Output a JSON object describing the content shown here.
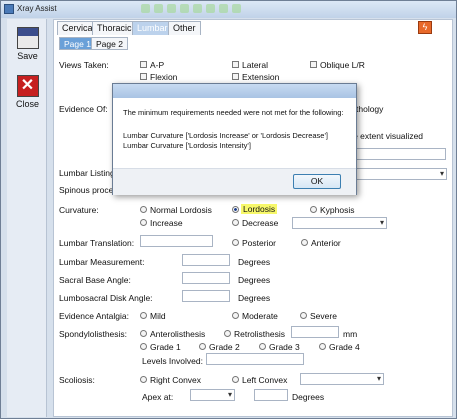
{
  "window": {
    "title": "Xray Assist"
  },
  "toolbar": {
    "save_label": "Save",
    "close_label": "Close"
  },
  "tabs": [
    "Cervical",
    "Thoracic",
    "Lumbar",
    "Other"
  ],
  "subtabs": [
    "Page 1",
    "Page 2"
  ],
  "views": {
    "label": "Views Taken:",
    "options": [
      "A-P",
      "Lateral",
      "Oblique L/R",
      "Flexion",
      "Extension"
    ]
  },
  "evidence": {
    "label": "Evidence Of:",
    "partial_right_1": "thology",
    "partial_right_2": "the extent visualized"
  },
  "listing": {
    "label": "Lumbar Listing"
  },
  "spinous": {
    "label": "Spinous proce"
  },
  "curvature": {
    "label": "Curvature:",
    "options": [
      "Normal Lordosis",
      "Lordosis",
      "Kyphosis",
      "Increase",
      "Decrease"
    ]
  },
  "translation": {
    "label": "Lumbar Translation:",
    "options": [
      "Posterior",
      "Anterior"
    ]
  },
  "measurement": {
    "label": "Lumbar Measurement:",
    "unit": "Degrees"
  },
  "sacral": {
    "label": "Sacral Base Angle:",
    "unit": "Degrees"
  },
  "lumbosacral": {
    "label": "Lumbosacral Disk Angle:",
    "unit": "Degrees"
  },
  "antalgia": {
    "label": "Evidence Antalgia:",
    "options": [
      "Mild",
      "Moderate",
      "Severe"
    ]
  },
  "spondy": {
    "label": "Spondylolisthesis:",
    "options": [
      "Anterolisthesis",
      "Retrolisthesis"
    ],
    "unit": "mm",
    "grades": [
      "Grade 1",
      "Grade 2",
      "Grade 3",
      "Grade 4"
    ],
    "levels_label": "Levels Involved:"
  },
  "scoliosis": {
    "label": "Scoliosis:",
    "options": [
      "Right Convex",
      "Left Convex"
    ],
    "apex_label": "Apex at:",
    "unit": "Degrees"
  },
  "dialog": {
    "line1": "The minimum requirements needed were not met for the following:",
    "line2": "Lumbar Curvature ['Lordosis Increase' or 'Lordosis Decrease']",
    "line3": "Lumbar Curvature ['Lordosis Intensity']",
    "ok_label": "OK"
  }
}
